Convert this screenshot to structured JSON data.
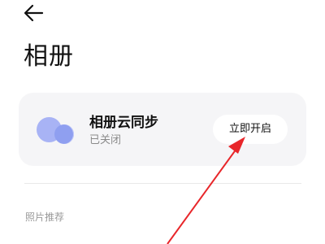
{
  "header": {
    "back_icon": "arrow-left-icon",
    "title": "相册"
  },
  "cloud_sync_card": {
    "icon": "cloud-album-icon",
    "title": "相册云同步",
    "status": "已关闭",
    "enable_button_label": "立即开启"
  },
  "section": {
    "label": "照片推荐"
  },
  "colors": {
    "card_background": "#f5f5f7",
    "icon_light": "#a8b3f5",
    "icon_dark": "#8f9ff0",
    "annotation_arrow": "#e8262a"
  }
}
